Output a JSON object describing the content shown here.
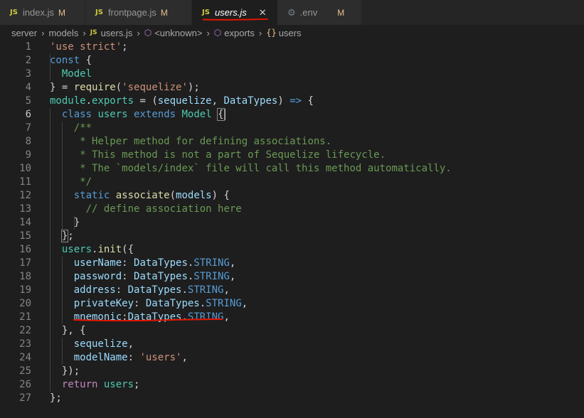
{
  "tabs": [
    {
      "badge": "JS",
      "label": "index.js",
      "status": "M"
    },
    {
      "badge": "JS",
      "label": "frontpage.js",
      "status": "M"
    },
    {
      "badge": "JS",
      "label": "users.js",
      "close": "✕"
    },
    {
      "label": ".env",
      "status": "M"
    }
  ],
  "breadcrumb": {
    "items": [
      "server",
      "models",
      "users.js",
      "<unknown>",
      "exports",
      "users"
    ],
    "file_badge": "JS"
  },
  "editor": {
    "active_line": 6,
    "line_numbers": [
      "1",
      "2",
      "3",
      "4",
      "5",
      "6",
      "7",
      "8",
      "9",
      "10",
      "11",
      "12",
      "13",
      "14",
      "15",
      "16",
      "17",
      "18",
      "19",
      "20",
      "21",
      "22",
      "23",
      "24",
      "25",
      "26",
      "27"
    ]
  },
  "colors": {
    "keyword": "#569cd6",
    "string": "#ce9178",
    "type": "#4ec9b0",
    "variable": "#9cdcfe",
    "function": "#dcdcaa",
    "comment": "#6a9955",
    "annotation_red": "#e51400"
  },
  "icons": {
    "gear": "gear-icon",
    "close": "close-icon",
    "chevron": "chevron-right-icon",
    "symbol": "cube-icon",
    "braces": "braces-icon"
  }
}
